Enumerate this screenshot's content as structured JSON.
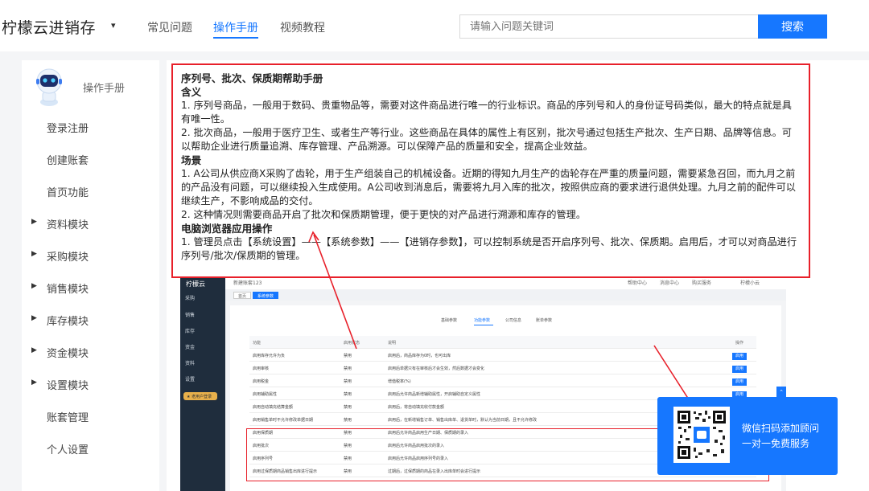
{
  "header": {
    "brand": "柠檬云进销存",
    "brand_caret": "▾",
    "nav": [
      {
        "label": "常见问题"
      },
      {
        "label": "操作手册"
      },
      {
        "label": "视频教程"
      }
    ],
    "active_nav": "操作手册",
    "search": {
      "placeholder": "请输入问题关键词",
      "button": "搜索"
    }
  },
  "sidebar": {
    "title": "操作手册",
    "items": [
      {
        "label": "登录注册",
        "expandable": false
      },
      {
        "label": "创建账套",
        "expandable": false
      },
      {
        "label": "首页功能",
        "expandable": false
      },
      {
        "label": "资料模块",
        "expandable": true
      },
      {
        "label": "采购模块",
        "expandable": true
      },
      {
        "label": "销售模块",
        "expandable": true
      },
      {
        "label": "库存模块",
        "expandable": true
      },
      {
        "label": "资金模块",
        "expandable": true
      },
      {
        "label": "设置模块",
        "expandable": true
      },
      {
        "label": "账套管理",
        "expandable": false
      },
      {
        "label": "个人设置",
        "expandable": false
      }
    ],
    "expand_glyph": "▶"
  },
  "doc": {
    "title": "序列号、批次、保质期帮助手册",
    "h_meaning": "含义",
    "p1": "1. 序列号商品，一般用于数码、贵重物品等，需要对这件商品进行唯一的行业标识。商品的序列号和人的身份证号码类似，最大的特点就是具有唯一性。",
    "p2": "2. 批次商品，一般用于医疗卫生、或者生产等行业。这些商品在具体的属性上有区别，批次号通过包括生产批次、生产日期、品牌等信息。可以帮助企业进行质量追溯、库存管理、产品溯源。可以保障产品的质量和安全，提高企业效益。",
    "h_scene": "场景",
    "p3": "1. A公司从供应商X采购了齿轮，用于生产组装自己的机械设备。近期的得知九月生产的齿轮存在严重的质量问题，需要紧急召回，而九月之前的产品没有问题，可以继续投入生成使用。A公司收到消息后，需要将九月入库的批次，按照供应商的要求进行退供处理。九月之前的配件可以继续生产，不影响成品的交付。",
    "p4": "2. 这种情况则需要商品开启了批次和保质期管理，便于更快的对产品进行溯源和库存的管理。",
    "h_web": "电脑浏览器应用操作",
    "p5": "1. 管理员点击【系统设置】——【系统参数】——【进销存参数】，可以控制系统是否开启序列号、批次、保质期。启用后，才可以对商品进行序列号/批次/保质期的管理。"
  },
  "embedded": {
    "logo": "柠檬云",
    "nav": [
      "采购",
      "销售",
      "库存",
      "资金",
      "资料",
      "设置"
    ],
    "pill": "★ 老用户登录",
    "top": {
      "account": "新建账套123",
      "links": [
        "帮助中心",
        "消息中心",
        "购买服务"
      ],
      "user": "柠檬小云"
    },
    "tabs": [
      "首页",
      "系统参数"
    ],
    "subtabs": [
      "基础参数",
      "功能参数",
      "公司信息",
      "账单参数"
    ],
    "headers": [
      "功能",
      "启用状态",
      "说明",
      "操作"
    ],
    "rows": [
      {
        "f": "启用库存允许为负",
        "s": "禁用",
        "d": "启用后，商品库存为0时，也可出库",
        "btn": true
      },
      {
        "f": "启用审核",
        "s": "禁用",
        "d": "启用后单据只有在审核后才会生效，然后数据才会变化",
        "btn": true
      },
      {
        "f": "启用税金",
        "s": "禁用",
        "d": "增值税率(%)",
        "btn": true
      },
      {
        "f": "启用辅助属性",
        "s": "禁用",
        "d": "启用后允许商品新增辅助属性，开启辅助自定义属性",
        "btn": true
      },
      {
        "f": "启用自动填充结算金额",
        "s": "禁用",
        "d": "启用后，将自动填充收付款金额",
        "btn": false
      },
      {
        "f": "启用销售单时不允许修改单据日期",
        "s": "禁用",
        "d": "启用后，在新增销售订单、销售出库单、退货单时，默认为当前日期，且不允许修改",
        "btn": false
      },
      {
        "f": "启用保质期",
        "s": "禁用",
        "d": "启用后允许商品启用生产日期、保质期的录入",
        "btn": false
      },
      {
        "f": "启用批次",
        "s": "禁用",
        "d": "启用后允许商品启用批次的录入",
        "btn": false
      },
      {
        "f": "启用序列号",
        "s": "禁用",
        "d": "启用后允许商品启用序列号的录入",
        "btn": false
      },
      {
        "f": "启用过保质期商品销售出库进行提示",
        "s": "禁用",
        "d": "过期后，过保质期的商品在录入出库单时会进行提示",
        "btn": false
      }
    ],
    "btn_label": "启用"
  },
  "qr": {
    "line1": "微信扫码添加顾问",
    "line2": "一对一免费服务"
  },
  "colors": {
    "accent": "#1677ff",
    "highlight": "#e8202a",
    "sidebar_dark": "#1f2d3d"
  }
}
